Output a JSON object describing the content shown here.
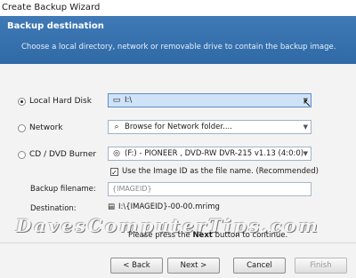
{
  "window": {
    "title": "Create Backup Wizard"
  },
  "header": {
    "title": "Backup destination",
    "subtitle": "Choose a local directory, network  or removable drive to contain the backup image."
  },
  "options": {
    "local": {
      "label": "Local Hard Disk",
      "value": "I:\\",
      "icon": "drive-icon"
    },
    "network": {
      "label": "Network",
      "value": "Browse for Network folder....",
      "icon": "search-icon"
    },
    "cd": {
      "label": "CD / DVD Burner",
      "value": "(F:) - PIONEER , DVD-RW  DVR-215  v1.13 (4:0:0)",
      "icon": "disc-icon"
    }
  },
  "image_id_check": {
    "label": "Use the Image ID as the file name.  (Recommended)"
  },
  "filename": {
    "label": "Backup filename:",
    "placeholder": "{IMAGEID}"
  },
  "destination": {
    "label": "Destination:",
    "value": "I:\\{IMAGEID}-00-00.mrimg"
  },
  "watermark": "DavesComputerTips.com",
  "hint": {
    "prefix": "Please press the ",
    "bold": "Next",
    "suffix": " button to continue."
  },
  "buttons": {
    "back": "< Back",
    "next": "Next >",
    "cancel": "Cancel",
    "finish": "Finish"
  }
}
